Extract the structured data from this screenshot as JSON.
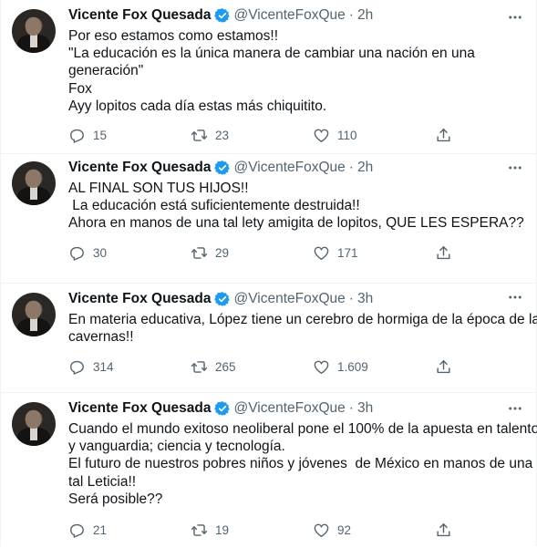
{
  "tweets": [
    {
      "author_name": "Vicente Fox Quesada",
      "handle": "@VicenteFoxQue",
      "time": "2h",
      "lines": [
        "Por eso estamos como estamos!!",
        "\"La educación es la única manera de cambiar una nación en una",
        "generación\"",
        "Fox",
        "Ayy lopitos cada día estas más chiquitito."
      ],
      "replies": "15",
      "retweets": "23",
      "likes": "110"
    },
    {
      "author_name": "Vicente Fox Quesada",
      "handle": "@VicenteFoxQue",
      "time": "2h",
      "lines": [
        "AL FINAL SON TUS HIJOS!!",
        " La educación está suficientemente destruida!!",
        "Ahora en manos de una tal lety amigita de lopitos, QUE LES ESPERA??"
      ],
      "replies": "30",
      "retweets": "29",
      "likes": "171"
    },
    {
      "author_name": "Vicente Fox Quesada",
      "handle": "@VicenteFoxQue",
      "time": "3h",
      "lines": [
        "En materia educativa, López tiene un cerebro de hormiga de la época de las",
        "cavernas!!"
      ],
      "replies": "314",
      "retweets": "265",
      "likes": "1.609"
    },
    {
      "author_name": "Vicente Fox Quesada",
      "handle": "@VicenteFoxQue",
      "time": "3h",
      "lines": [
        "Cuando el mundo exitoso neoliberal pone el 100% de la apuesta en talento",
        "y vanguardia; ciencia y tecnología.",
        "El futuro de nuestros pobres niños y jóvenes  de México en manos de una",
        "tal Leticia!!",
        "Será posible??"
      ],
      "replies": "21",
      "retweets": "19",
      "likes": "92"
    }
  ],
  "icons": {
    "verified": "verified-badge-icon",
    "more": "more-options-icon",
    "reply": "reply-icon",
    "retweet": "retweet-icon",
    "like": "like-icon",
    "share": "share-icon"
  },
  "colors": {
    "text": "#0f1419",
    "secondary": "#536471",
    "verified": "#1d9bf0",
    "divider": "#eff3f4"
  }
}
